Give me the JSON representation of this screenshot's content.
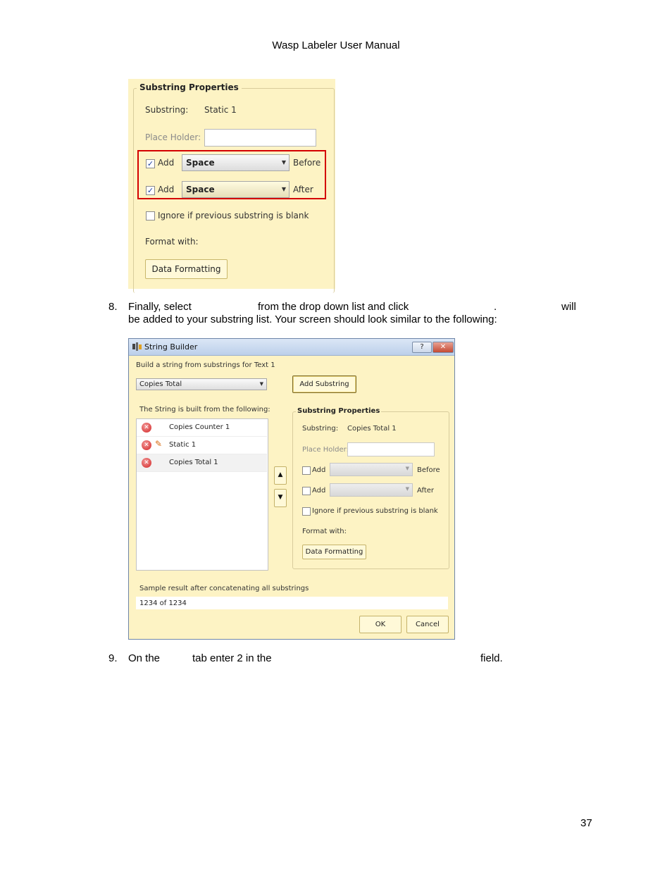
{
  "page": {
    "header": "Wasp Labeler User Manual",
    "page_number": "37"
  },
  "substring_panel": {
    "legend": "Substring Properties",
    "substring_label": "Substring:",
    "substring_value": "Static 1",
    "placeholder_label": "Place Holder:",
    "add_label": "Add",
    "before_combo": "Space",
    "before_label": "Before",
    "after_combo": "Space",
    "after_label": "After",
    "ignore_label": "Ignore if previous substring is blank",
    "format_label": "Format with:",
    "data_formatting_button": "Data Formatting",
    "check_mark": "✓"
  },
  "step8": {
    "number": "8.",
    "line1_a": "Finally, select",
    "line1_b": "from the drop down list and click",
    "line1_c": ".",
    "line1_d": "will",
    "line2": "be added to your substring list.  Your screen should look similar to the following:"
  },
  "dialog": {
    "title": "String Builder",
    "help_button": "?",
    "close_button": "✕",
    "subtitle": "Build a string from substrings for Text 1",
    "type_combo": "Copies Total",
    "add_substring_button": "Add Substring",
    "list_caption": "The String is built from the following:",
    "list_items": [
      {
        "label": "Copies Counter 1"
      },
      {
        "label": "Static 1"
      },
      {
        "label": "Copies Total 1"
      }
    ],
    "up_button": "▲",
    "down_button": "▼",
    "props": {
      "legend": "Substring Properties",
      "substring_label": "Substring:",
      "substring_value": "Copies Total 1",
      "placeholder_label": "Place Holder:",
      "add_label": "Add",
      "before_label": "Before",
      "after_label": "After",
      "ignore_label": "Ignore if previous substring is blank",
      "format_label": "Format with:",
      "data_formatting_button": "Data Formatting"
    },
    "sample_label": "Sample result after concatenating all substrings",
    "sample_value": "1234 of 1234",
    "ok_button": "OK",
    "cancel_button": "Cancel"
  },
  "step9": {
    "number": "9.",
    "part_a": "On the",
    "part_b": "tab enter 2 in the",
    "part_c": "field."
  }
}
